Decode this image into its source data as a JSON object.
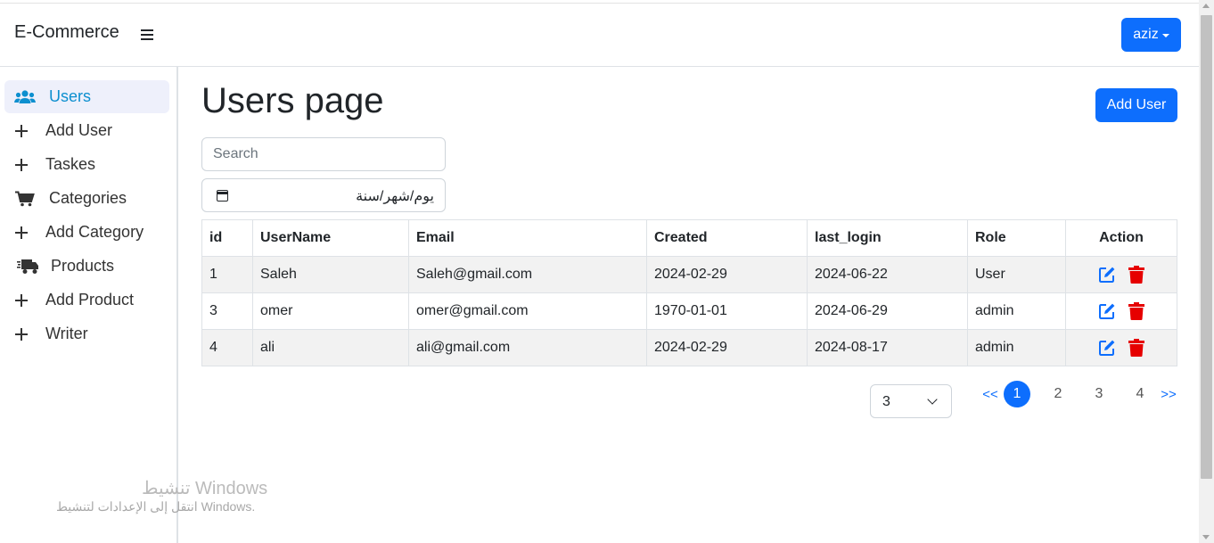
{
  "navbar": {
    "brand": "E-Commerce",
    "user_menu_label": "aziz"
  },
  "sidebar": {
    "items": [
      {
        "label": "Users",
        "icon": "users-icon",
        "active": true
      },
      {
        "label": "Add User",
        "icon": "plus-icon"
      },
      {
        "label": "Taskes",
        "icon": "plus-icon"
      },
      {
        "label": "Categories",
        "icon": "cart-icon"
      },
      {
        "label": "Add Category",
        "icon": "plus-icon"
      },
      {
        "label": "Products",
        "icon": "truck-icon"
      },
      {
        "label": "Add Product",
        "icon": "plus-icon"
      },
      {
        "label": "Writer",
        "icon": "plus-icon"
      }
    ]
  },
  "main": {
    "title": "Users page",
    "add_button_label": "Add User",
    "search": {
      "placeholder": "Search",
      "value": ""
    },
    "date_filter": {
      "value": "يوم/شهر/سنة"
    },
    "table": {
      "headers": [
        "id",
        "UserName",
        "Email",
        "Created",
        "last_login",
        "Role",
        "Action"
      ],
      "rows": [
        {
          "id": "1",
          "username": "Saleh",
          "email": "Saleh@gmail.com",
          "created": "2024-02-29",
          "last_login": "2024-06-22",
          "role": "User"
        },
        {
          "id": "3",
          "username": "omer",
          "email": "omer@gmail.com",
          "created": "1970-01-01",
          "last_login": "2024-06-29",
          "role": "admin"
        },
        {
          "id": "4",
          "username": "ali",
          "email": "ali@gmail.com",
          "created": "2024-02-29",
          "last_login": "2024-08-17",
          "role": "admin"
        }
      ]
    },
    "page_size": "3",
    "pagination": {
      "prev": "<<",
      "pages": [
        "1",
        "2",
        "3",
        "4"
      ],
      "current": "1",
      "next": ">>"
    }
  },
  "watermark": {
    "line1": "تنشيط Windows",
    "line2": "انتقل إلى الإعدادات لتنشيط Windows."
  },
  "colors": {
    "primary": "#0d6efd",
    "active_item_bg": "#eef0fb",
    "active_item_text": "#0d8fcf",
    "delete_red": "#e60000",
    "striped_row": "#f2f2f2"
  }
}
